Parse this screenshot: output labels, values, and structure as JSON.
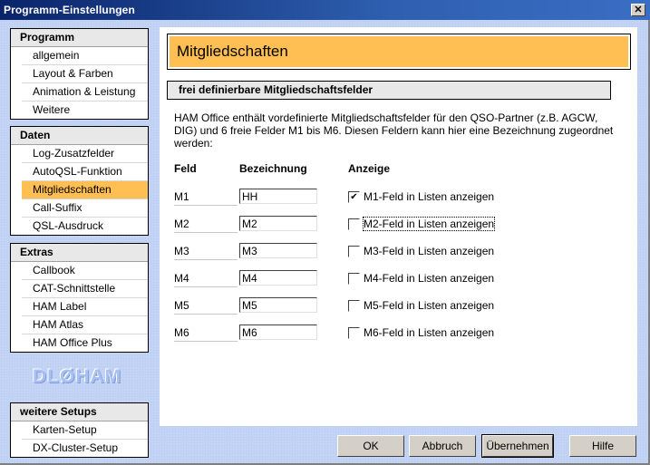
{
  "window": {
    "title": "Programm-Einstellungen",
    "close_icon": "close-icon"
  },
  "sidebar": {
    "groups": [
      {
        "label": "Programm",
        "items": [
          "allgemein",
          "Layout & Farben",
          "Animation & Leistung",
          "Weitere"
        ]
      },
      {
        "label": "Daten",
        "items": [
          "Log-Zusatzfelder",
          "AutoQSL-Funktion",
          "Mitgliedschaften",
          "Call-Suffix",
          "QSL-Ausdruck"
        ],
        "active": "Mitgliedschaften"
      },
      {
        "label": "Extras",
        "items": [
          "Callbook",
          "CAT-Schnittstelle",
          "HAM Label",
          "HAM Atlas",
          "HAM Office Plus"
        ]
      },
      {
        "label": "weitere Setups",
        "items": [
          "Karten-Setup",
          "DX-Cluster-Setup"
        ]
      }
    ],
    "logo": "DLØHAM"
  },
  "main": {
    "title": "Mitgliedschaften",
    "section_title": "frei definierbare Mitgliedschaftsfelder",
    "description": "HAM Office enthält vordefinierte Mitgliedschaftsfelder für den QSO-Partner (z.B. AGCW, DIG) und  6 freie Felder  M1 bis M6. Diesen Feldern kann hier eine Bezeichnung zugeordnet werden:",
    "columns": {
      "feld": "Feld",
      "bezeichnung": "Bezeichnung",
      "anzeige": "Anzeige"
    },
    "rows": [
      {
        "feld": "M1",
        "value": "HH",
        "checked": true,
        "label": "M1-Feld in Listen anzeigen"
      },
      {
        "feld": "M2",
        "value": "M2",
        "checked": false,
        "label": "M2-Feld in Listen anzeigen"
      },
      {
        "feld": "M3",
        "value": "M3",
        "checked": false,
        "label": "M3-Feld in Listen anzeigen"
      },
      {
        "feld": "M4",
        "value": "M4",
        "checked": false,
        "label": "M4-Feld in Listen anzeigen"
      },
      {
        "feld": "M5",
        "value": "M5",
        "checked": false,
        "label": "M5-Feld in Listen anzeigen"
      },
      {
        "feld": "M6",
        "value": "M6",
        "checked": false,
        "label": "M6-Feld in Listen anzeigen"
      }
    ]
  },
  "buttons": {
    "ok": "OK",
    "cancel": "Abbruch",
    "apply": "Übernehmen",
    "help": "Hilfe"
  },
  "colors": {
    "accent": "#ffbf52",
    "titlebar": "#0a246a",
    "background": "#c3d3f3"
  }
}
